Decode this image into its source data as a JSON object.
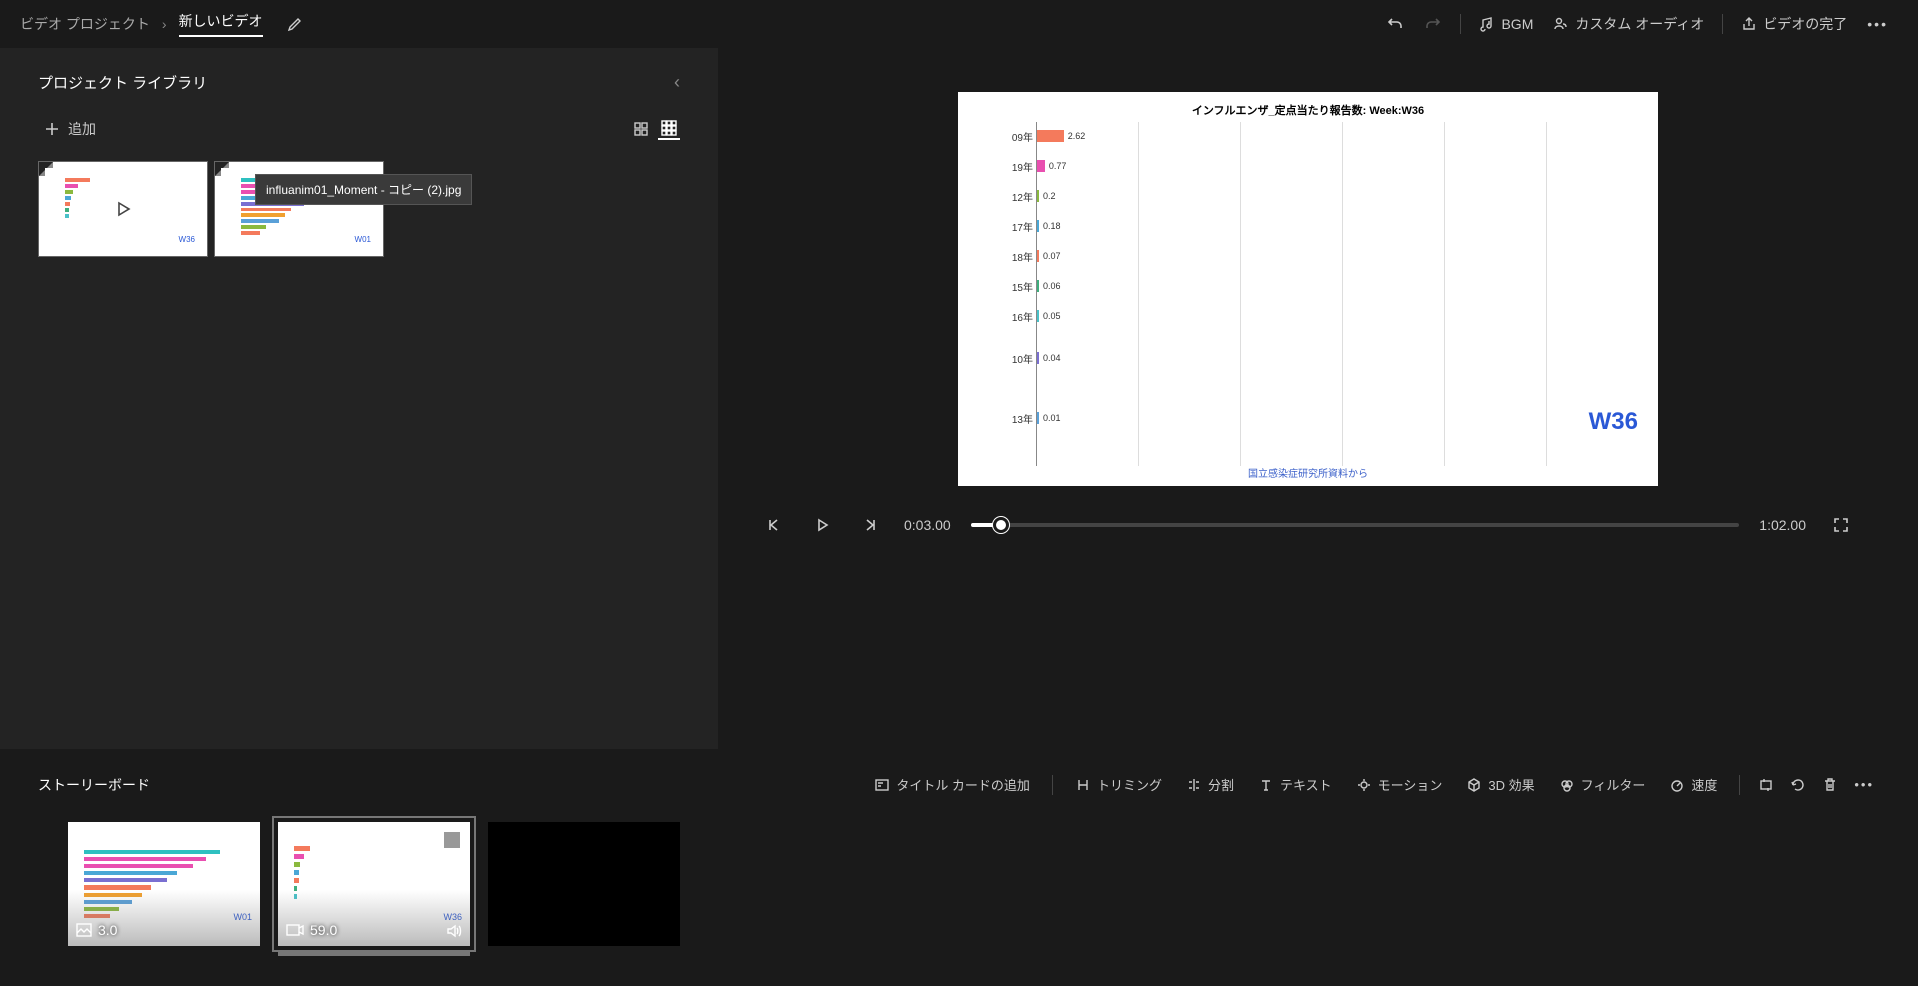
{
  "topbar": {
    "breadcrumb_root": "ビデオ プロジェクト",
    "breadcrumb_current": "新しいビデオ",
    "bgm": "BGM",
    "custom_audio": "カスタム オーディオ",
    "finish": "ビデオの完了"
  },
  "library": {
    "title": "プロジェクト ライブラリ",
    "add": "追加",
    "tooltip": "influanim01_Moment - コピー (2).jpg",
    "thumb1_week": "W36",
    "thumb2_week": "W01"
  },
  "preview": {
    "chart_title": "インフルエンザ_定点当たり報告数: Week:W36",
    "week_label": "W36",
    "source": "国立感染症研究所資料から",
    "current_time": "0:03.00",
    "total_time": "1:02.00"
  },
  "chart_data": {
    "type": "bar",
    "orientation": "horizontal",
    "title": "インフルエンザ_定点当たり報告数: Week:W36",
    "xlabel": "",
    "ylabel": "",
    "xlim": [
      0,
      60
    ],
    "categories": [
      "09年",
      "19年",
      "12年",
      "17年",
      "18年",
      "15年",
      "16年",
      "10年",
      "13年"
    ],
    "values": [
      2.62,
      0.77,
      0.2,
      0.18,
      0.07,
      0.06,
      0.05,
      0.04,
      0.01
    ],
    "colors": [
      "#f47a5c",
      "#e94fb0",
      "#8bb93e",
      "#4aa7d6",
      "#f47a5c",
      "#3fae7d",
      "#4ac1c8",
      "#7a6fd1",
      "#5aa0d8"
    ],
    "annotations": [
      "W36"
    ],
    "source": "国立感染症研究所資料から"
  },
  "storyboard": {
    "title": "ストーリーボード",
    "add_title_card": "タイトル カードの追加",
    "trimming": "トリミング",
    "split": "分割",
    "text": "テキスト",
    "motion": "モーション",
    "effect3d": "3D 効果",
    "filter": "フィルター",
    "speed": "速度",
    "clip1_duration": "3.0",
    "clip1_week": "W01",
    "clip2_duration": "59.0",
    "clip2_week": "W36"
  }
}
